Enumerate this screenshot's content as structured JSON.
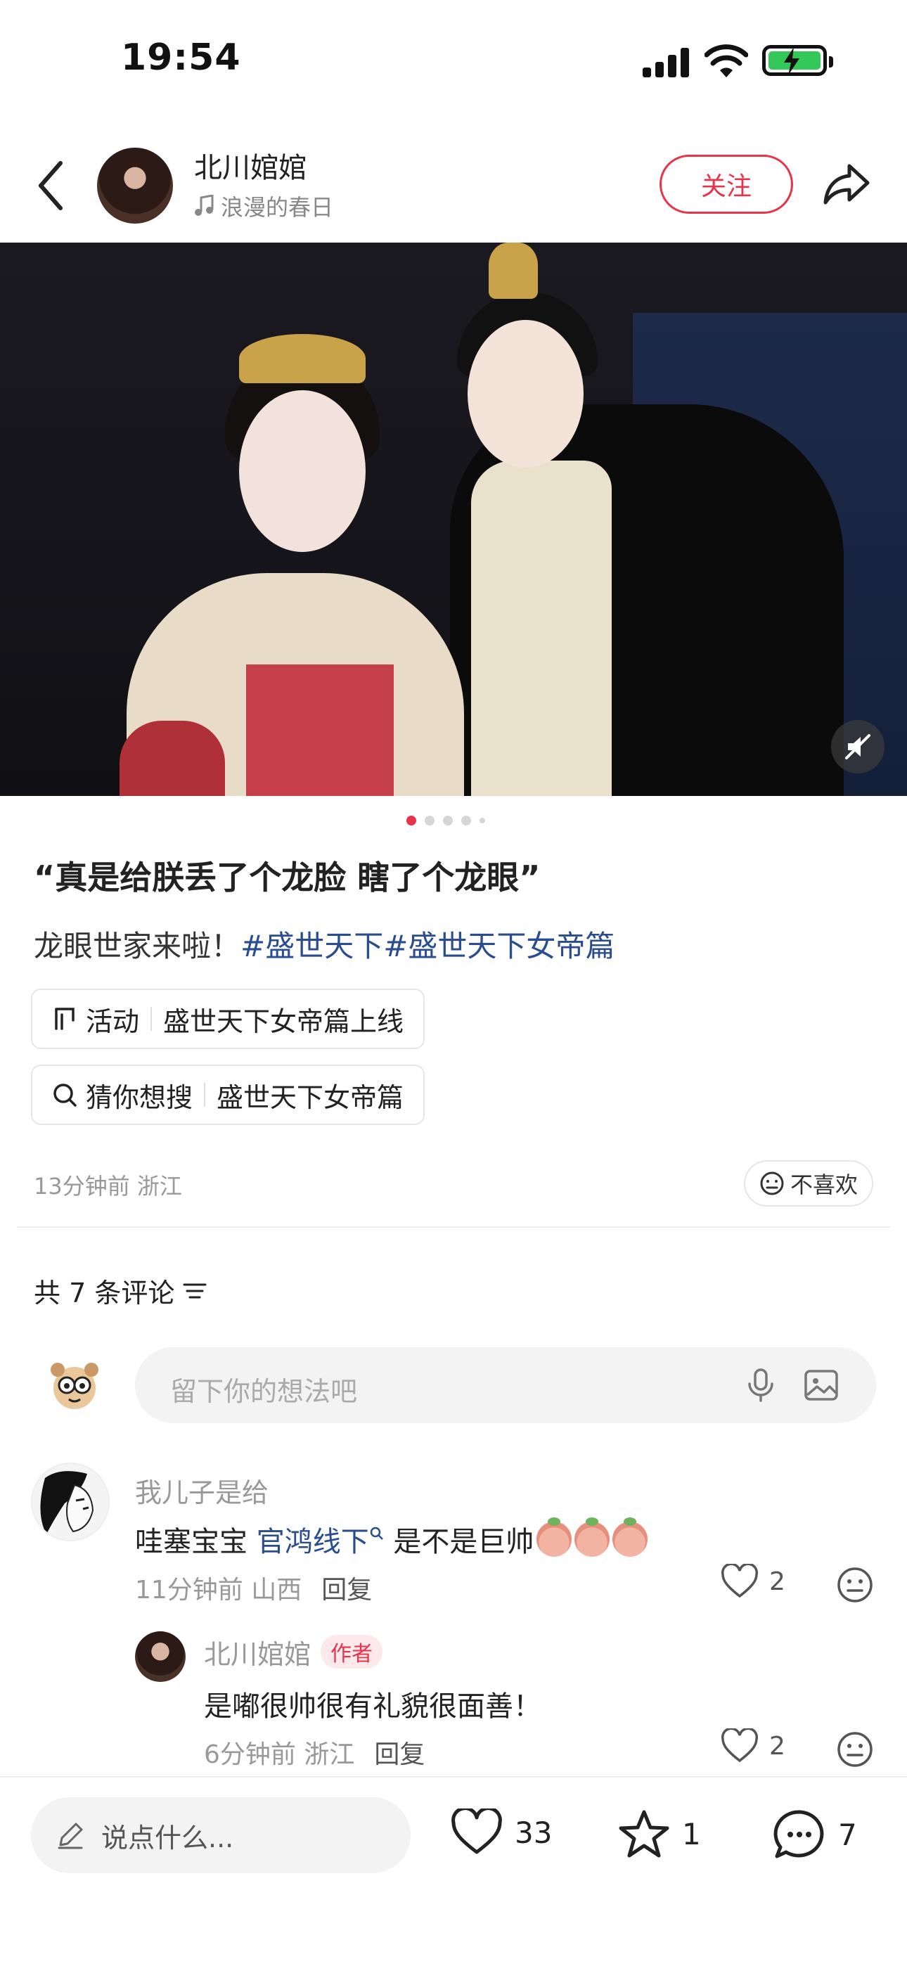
{
  "status_bar": {
    "time": "19:54"
  },
  "header": {
    "author_name": "北川婠婠",
    "music": "浪漫的春日",
    "follow_label": "关注"
  },
  "carousel": {
    "count": 5,
    "active": 0
  },
  "post": {
    "title": "“真是给朕丢了个龙脸 瞎了个龙眼”",
    "body_text": "龙眼世家来啦！",
    "tags": [
      "#盛世天下",
      "#盛世天下女帝篇"
    ],
    "activity_chip": {
      "label": "活动",
      "value": "盛世天下女帝篇上线"
    },
    "search_chip": {
      "label": "猜你想搜",
      "value": "盛世天下女帝篇"
    },
    "time_location": "13分钟前 浙江",
    "dislike_label": "不喜欢"
  },
  "comments_section": {
    "count_label": "共 7 条评论",
    "input_placeholder": "留下你的想法吧"
  },
  "comments": [
    {
      "name": "我儿子是给",
      "text_before": "哇塞宝宝 ",
      "link": "官鸿线下",
      "text_after": " 是不是巨帅",
      "meta": "11分钟前 山西",
      "reply_label": "回复",
      "likes": "2"
    },
    {
      "name": "北川婠婠",
      "badge": "作者",
      "text": "是嘟很帅很有礼貌很面善！",
      "meta": "6分钟前 浙江",
      "reply_label": "回复",
      "likes": "2"
    }
  ],
  "bottom_bar": {
    "input_placeholder": "说点什么...",
    "likes": "33",
    "favorites": "1",
    "comments": "7"
  },
  "colors": {
    "accent": "#e8344a",
    "tag": "#2a4d8f"
  }
}
